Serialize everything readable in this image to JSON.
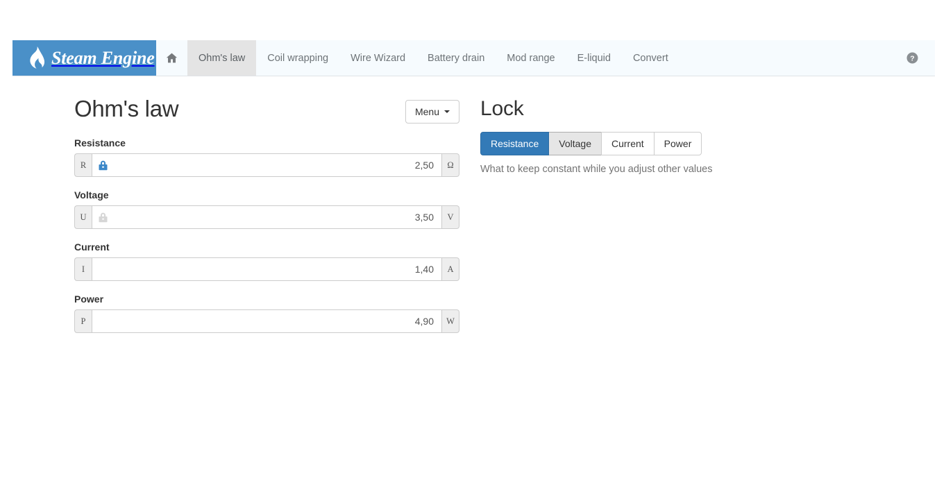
{
  "navbar": {
    "brand": "Steam Engine",
    "brand_icon": "flame-icon",
    "home_icon": "home-icon",
    "help_icon": "help-circle-icon",
    "brand_bg": "#4a90c8",
    "bar_bg": "#f6fbfe",
    "items": [
      {
        "label": "Ohm's law",
        "active": true
      },
      {
        "label": "Coil wrapping",
        "active": false
      },
      {
        "label": "Wire Wizard",
        "active": false
      },
      {
        "label": "Battery drain",
        "active": false
      },
      {
        "label": "Mod range",
        "active": false
      },
      {
        "label": "E-liquid",
        "active": false
      },
      {
        "label": "Convert",
        "active": false
      }
    ]
  },
  "calculator": {
    "title": "Ohm's law",
    "menu_label": "Menu",
    "fields": [
      {
        "label": "Resistance",
        "symbol": "R",
        "value": "2,50",
        "unit": "Ω",
        "lock_icon": "lock-icon",
        "lock_state": "locked",
        "lock_color": "#3b87c8"
      },
      {
        "label": "Voltage",
        "symbol": "U",
        "value": "3,50",
        "unit": "V",
        "lock_icon": "lock-icon",
        "lock_state": "unlocked-hover",
        "lock_color": "#d4d4d4"
      },
      {
        "label": "Current",
        "symbol": "I",
        "value": "1,40",
        "unit": "A",
        "lock_icon": "",
        "lock_state": "none",
        "lock_color": ""
      },
      {
        "label": "Power",
        "symbol": "P",
        "value": "4,90",
        "unit": "W",
        "lock_icon": "",
        "lock_state": "none",
        "lock_color": ""
      }
    ]
  },
  "lock_panel": {
    "title": "Lock",
    "options": [
      {
        "label": "Resistance",
        "state": "active"
      },
      {
        "label": "Voltage",
        "state": "hovered"
      },
      {
        "label": "Current",
        "state": "normal"
      },
      {
        "label": "Power",
        "state": "normal"
      }
    ],
    "help_text": "What to keep constant while you adjust other values",
    "active_color": "#337ab7"
  }
}
